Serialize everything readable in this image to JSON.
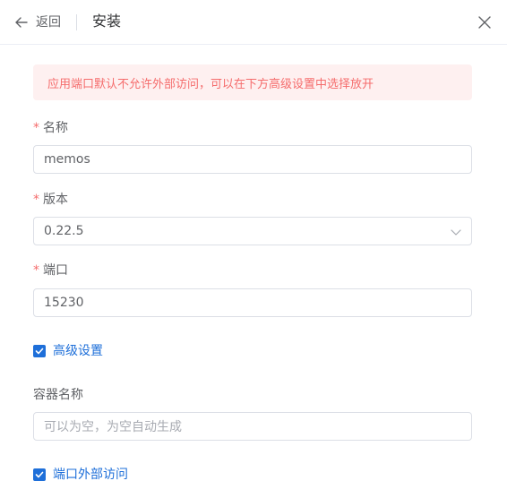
{
  "header": {
    "back_label": "返回",
    "title": "安装"
  },
  "alert": {
    "text": "应用端口默认不允许外部访问，可以在下方高级设置中选择放开"
  },
  "form": {
    "name": {
      "label": "名称",
      "required_mark": "*",
      "value": "memos"
    },
    "version": {
      "label": "版本",
      "required_mark": "*",
      "value": "0.22.5"
    },
    "port": {
      "label": "端口",
      "required_mark": "*",
      "value": "15230"
    },
    "advanced": {
      "label": "高级设置",
      "checked": true
    },
    "container_name": {
      "label": "容器名称",
      "value": "",
      "placeholder": "可以为空，为空自动生成"
    },
    "external_access": {
      "label": "端口外部访问",
      "checked": true
    }
  },
  "colors": {
    "accent": "#1e6fd9",
    "alert_bg": "#fef0f0",
    "alert_text": "#f56c6c"
  },
  "icons": [
    "back-arrow-icon",
    "close-icon",
    "chevron-down-icon",
    "check-icon"
  ]
}
